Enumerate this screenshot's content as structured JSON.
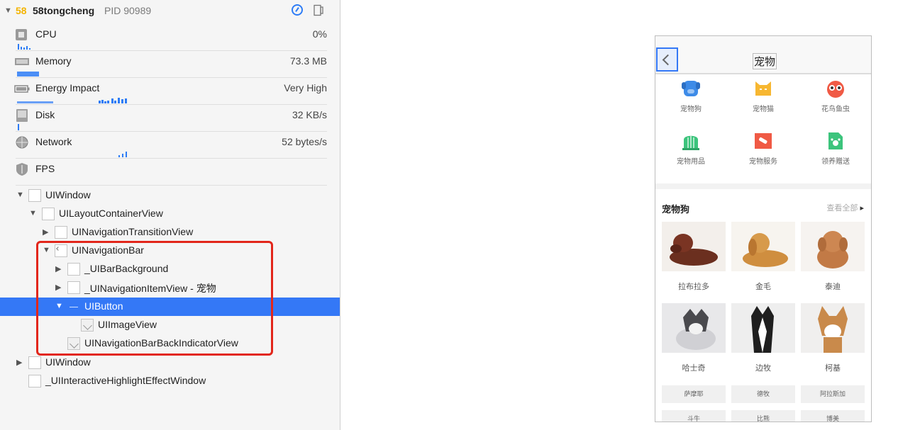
{
  "process": {
    "app_icon_text": "58",
    "name": "58tongcheng",
    "pid": "PID 90989"
  },
  "gauges": [
    {
      "label": "CPU",
      "value": "0%"
    },
    {
      "label": "Memory",
      "value": "73.3 MB"
    },
    {
      "label": "Energy Impact",
      "value": "Very High"
    },
    {
      "label": "Disk",
      "value": "32 KB/s"
    },
    {
      "label": "Network",
      "value": "52 bytes/s"
    },
    {
      "label": "FPS",
      "value": ""
    }
  ],
  "view_tree": [
    {
      "label": "UIWindow",
      "expanded": true
    },
    {
      "label": "UILayoutContainerView",
      "expanded": true
    },
    {
      "label": "UINavigationTransitionView",
      "expanded": false
    },
    {
      "label": "UINavigationBar",
      "expanded": true
    },
    {
      "label": "_UIBarBackground",
      "expanded": false
    },
    {
      "label": "_UINavigationItemView - 宠物",
      "expanded": false
    },
    {
      "label": "UIButton",
      "expanded": true,
      "selected": true
    },
    {
      "label": "UIImageView"
    },
    {
      "label": "UINavigationBarBackIndicatorView"
    },
    {
      "label": "UIWindow",
      "expanded": false
    },
    {
      "label": "_UIInteractiveHighlightEffectWindow"
    }
  ],
  "phone": {
    "nav_title": "宠物",
    "categories": [
      {
        "label": "宠物狗",
        "icon": "dog-icon",
        "color": "#3d8be8"
      },
      {
        "label": "宠物猫",
        "icon": "cat-icon",
        "color": "#f7b731"
      },
      {
        "label": "花鸟鱼虫",
        "icon": "owl-icon",
        "color": "#f05a45"
      },
      {
        "label": "宠物用品",
        "icon": "birdcage-icon",
        "color": "#3cc47c"
      },
      {
        "label": "宠物服务",
        "icon": "service-icon",
        "color": "#f05a45"
      },
      {
        "label": "领养赠送",
        "icon": "adopt-icon",
        "color": "#3cc47c"
      }
    ],
    "section_title": "宠物狗",
    "see_all": "查看全部",
    "dogs": [
      {
        "name": "拉布拉多"
      },
      {
        "name": "金毛"
      },
      {
        "name": "泰迪"
      },
      {
        "name": "哈士奇"
      },
      {
        "name": "边牧"
      },
      {
        "name": "柯基"
      }
    ],
    "tags": [
      "萨摩耶",
      "德牧",
      "阿拉斯加",
      "斗牛",
      "比熊",
      "博美"
    ]
  },
  "colors": {
    "selection": "#3478f6",
    "highlight_box": "#e2261b",
    "sparkline": "#2d7cf6"
  }
}
